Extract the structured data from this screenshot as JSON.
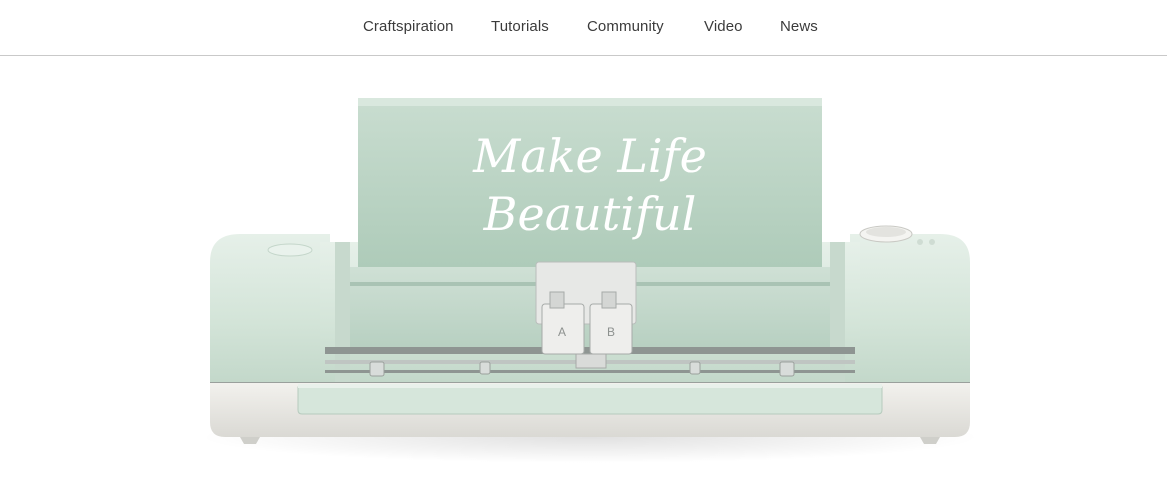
{
  "nav": {
    "items": [
      {
        "label": "Craftspiration"
      },
      {
        "label": "Tutorials"
      },
      {
        "label": "Community"
      },
      {
        "label": "Video"
      },
      {
        "label": "News"
      }
    ]
  },
  "hero": {
    "tagline_line1": "Make Life",
    "tagline_line2": "Beautiful",
    "carriage_labels": {
      "left": "A",
      "right": "B"
    },
    "colors": {
      "machine_body": "#dbe9df",
      "machine_lid": "#bcd5c6",
      "machine_base": "#ecebe6",
      "accent_trim": "#9aa09c"
    }
  }
}
